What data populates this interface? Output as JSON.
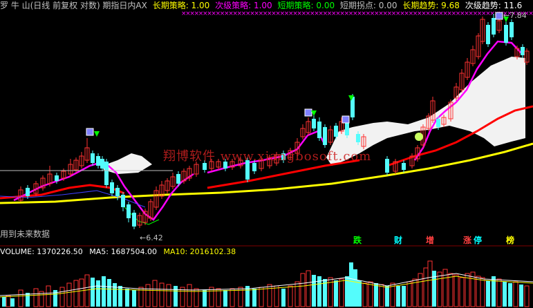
{
  "header": {
    "title": "罗 牛 山(日线 前复权 对数) 期指日内AX",
    "items": [
      {
        "label": "长期策略: 1.00",
        "color": "#ffff00"
      },
      {
        "label": "次级策略: 1.00",
        "color": "#ff00ff"
      },
      {
        "label": "短期策略: 0.00",
        "color": "#00ff00"
      },
      {
        "label": "短期拐点: 0.00",
        "color": "#c0c0c0"
      },
      {
        "label": "长期趋势: 9.68",
        "color": "#ffff00"
      },
      {
        "label": "次级趋势: 11.6",
        "color": "#ffffff"
      }
    ]
  },
  "annotations": {
    "high_price": "7.84",
    "low_price": "6.42",
    "future_data_note": "用到未来数据",
    "watermark": "翔博软件 www.xiangbosoft.com"
  },
  "signal_tags": [
    {
      "text": "跌",
      "color": "#00ff00",
      "bg": "transparent"
    },
    {
      "text": "财",
      "color": "#00ffff",
      "bg": "transparent"
    },
    {
      "text": "增",
      "color": "#ff4040",
      "bg": "transparent"
    },
    {
      "text": "涨",
      "color": "#ff4040",
      "bg": "transparent"
    },
    {
      "text": "停",
      "color": "#00ffff",
      "bg": "transparent"
    },
    {
      "text": "榜",
      "color": "#ffff00",
      "bg": "transparent"
    }
  ],
  "volume": {
    "items": [
      {
        "label": "VOLUME: 1370226.50",
        "color": "#ffffff"
      },
      {
        "label": "MA5: 1687504.00",
        "color": "#ffffff"
      },
      {
        "label": "MA10: 2016102.38",
        "color": "#ffff00"
      }
    ]
  },
  "colors": {
    "up": "#ff3232",
    "down": "#54fcfc",
    "ma_long": "#ffff00",
    "ma_mid": "#ff0000",
    "ma_short": "#ff00ff",
    "band": "#ffffff"
  }
}
